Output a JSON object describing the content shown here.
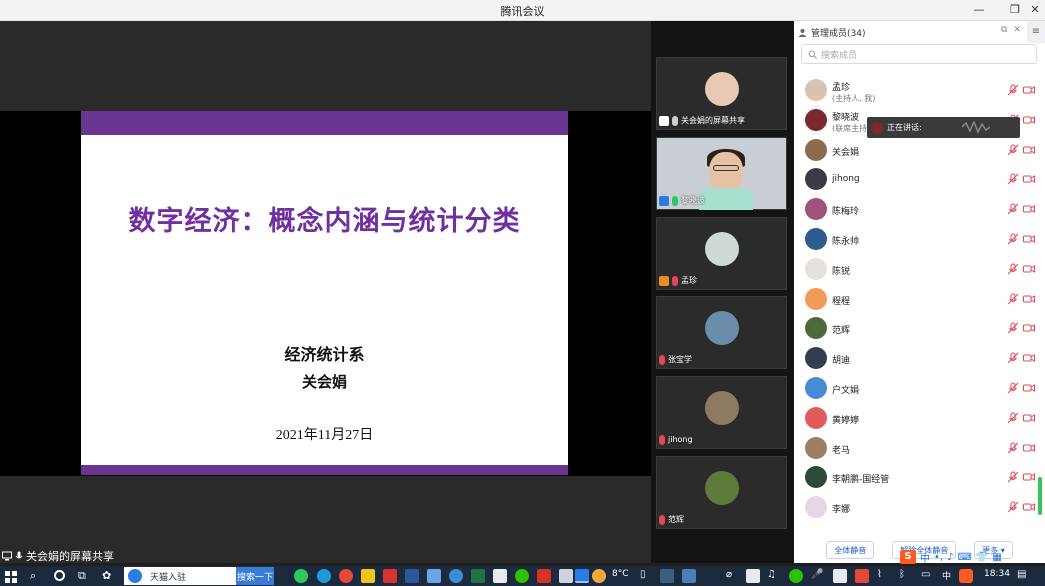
{
  "window": {
    "title": "腾讯会议"
  },
  "slide": {
    "headline": "数字经济：概念内涵与统计分类",
    "department": "经济统计系",
    "author": "关会娟",
    "date": "2021年11月27日"
  },
  "share_label": "关会娟的屏幕共享",
  "video_tiles": [
    {
      "name": "关会娟的屏幕共享",
      "avatar_color": "#e8c9b6"
    },
    {
      "name": "黎晓波",
      "avatar_color": "#e6c3a6"
    },
    {
      "name": "孟珍",
      "avatar_color": "#cfd9d6"
    },
    {
      "name": "张宝学",
      "avatar_color": "#6b8caa"
    },
    {
      "name": "jihong",
      "avatar_color": "#8c7a62"
    },
    {
      "name": "范辉",
      "avatar_color": "#5d7a3a"
    }
  ],
  "panel": {
    "title": "管理成员(34)",
    "search_placeholder": "搜索成员",
    "speaking_label": "正在讲话:",
    "members": [
      {
        "name": "孟珍",
        "sub": "(主持人, 我)",
        "avatar_color": "#d8c3b0"
      },
      {
        "name": "黎晓波",
        "sub": "(联席主持人)",
        "avatar_color": "#7a2a2a"
      },
      {
        "name": "关会娟",
        "sub": "",
        "avatar_color": "#8c6a4c"
      },
      {
        "name": "jihong",
        "sub": "",
        "avatar_color": "#3b3b46"
      },
      {
        "name": "陈梅玲",
        "sub": "",
        "avatar_color": "#a0527a"
      },
      {
        "name": "陈永帅",
        "sub": "",
        "avatar_color": "#2f5c8c"
      },
      {
        "name": "陈锐",
        "sub": "",
        "avatar_color": "#e6e0dc"
      },
      {
        "name": "程程",
        "sub": "",
        "avatar_color": "#f29a5a"
      },
      {
        "name": "范辉",
        "sub": "",
        "avatar_color": "#4c6a3a"
      },
      {
        "name": "胡迪",
        "sub": "",
        "avatar_color": "#333d52"
      },
      {
        "name": "户文娟",
        "sub": "",
        "avatar_color": "#4a8ad4"
      },
      {
        "name": "黄婷婷",
        "sub": "",
        "avatar_color": "#e25b5b"
      },
      {
        "name": "老马",
        "sub": "",
        "avatar_color": "#9a8060"
      },
      {
        "name": "李朝鹏-国经管",
        "sub": "",
        "avatar_color": "#2e4a3a"
      },
      {
        "name": "李娜",
        "sub": "",
        "avatar_color": "#e6d6e6"
      }
    ],
    "mute_all_label": "全体静音",
    "unmute_all_label": "解除全体静音",
    "more_label": "更多 ▾"
  },
  "taskbar": {
    "search_placeholder": "天猫入驻",
    "search_button": "搜索一下",
    "weather": "8°C",
    "ime_lang": "中",
    "ime_lang2": "中",
    "time": "18:34"
  },
  "colors": {
    "slide_purple": "#7030a0",
    "slide_bar": "#6a3692",
    "accent_blue": "#1a5fd6",
    "muted_red": "#e0485a"
  }
}
